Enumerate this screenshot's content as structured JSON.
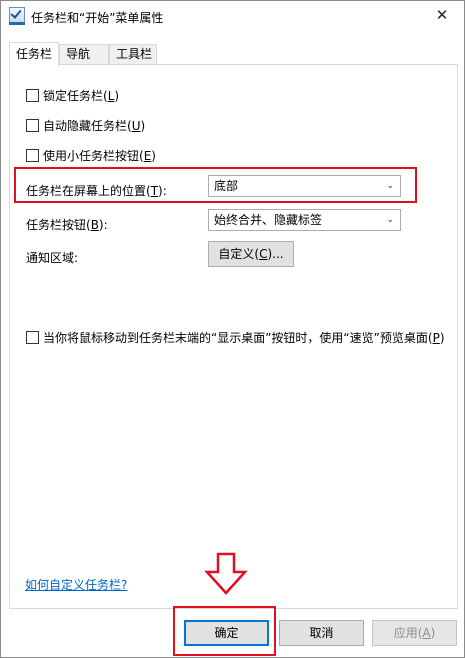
{
  "window": {
    "title": "任务栏和“开始”菜单属性",
    "close_glyph": "✕"
  },
  "tabs": [
    {
      "label": "任务栏",
      "active": true
    },
    {
      "label": "导航",
      "active": false
    },
    {
      "label": "工具栏",
      "active": false
    }
  ],
  "options": {
    "lock_taskbar": {
      "label": "锁定任务栏(",
      "key": "L",
      "suffix": ")",
      "checked": false
    },
    "auto_hide": {
      "label": "自动隐藏任务栏(",
      "key": "U",
      "suffix": ")",
      "checked": false
    },
    "small_buttons": {
      "label": "使用小任务栏按钮(",
      "key": "E",
      "suffix": ")",
      "checked": false
    }
  },
  "position": {
    "label": "任务栏在屏幕上的位置(",
    "key": "T",
    "suffix": "):",
    "value": "底部"
  },
  "buttons_combine": {
    "label": "任务栏按钮(",
    "key": "B",
    "suffix": "):",
    "value": "始终合并、隐藏标签"
  },
  "notification": {
    "label": "通知区域:",
    "button_label": "自定义(",
    "button_key": "C",
    "button_suffix": ")..."
  },
  "peek": {
    "label": "当你将鼠标移动到任务栏末端的“显示桌面”按钮时，使用“速览”预览桌面(",
    "key": "P",
    "suffix": ")",
    "checked": false
  },
  "help_link": "如何自定义任务栏?",
  "footer": {
    "ok": "确定",
    "cancel": "取消",
    "apply_label": "应用(",
    "apply_key": "A",
    "apply_suffix": ")"
  },
  "colors": {
    "highlight": "#e0101e",
    "link": "#0066cc",
    "accent": "#0078d7"
  }
}
